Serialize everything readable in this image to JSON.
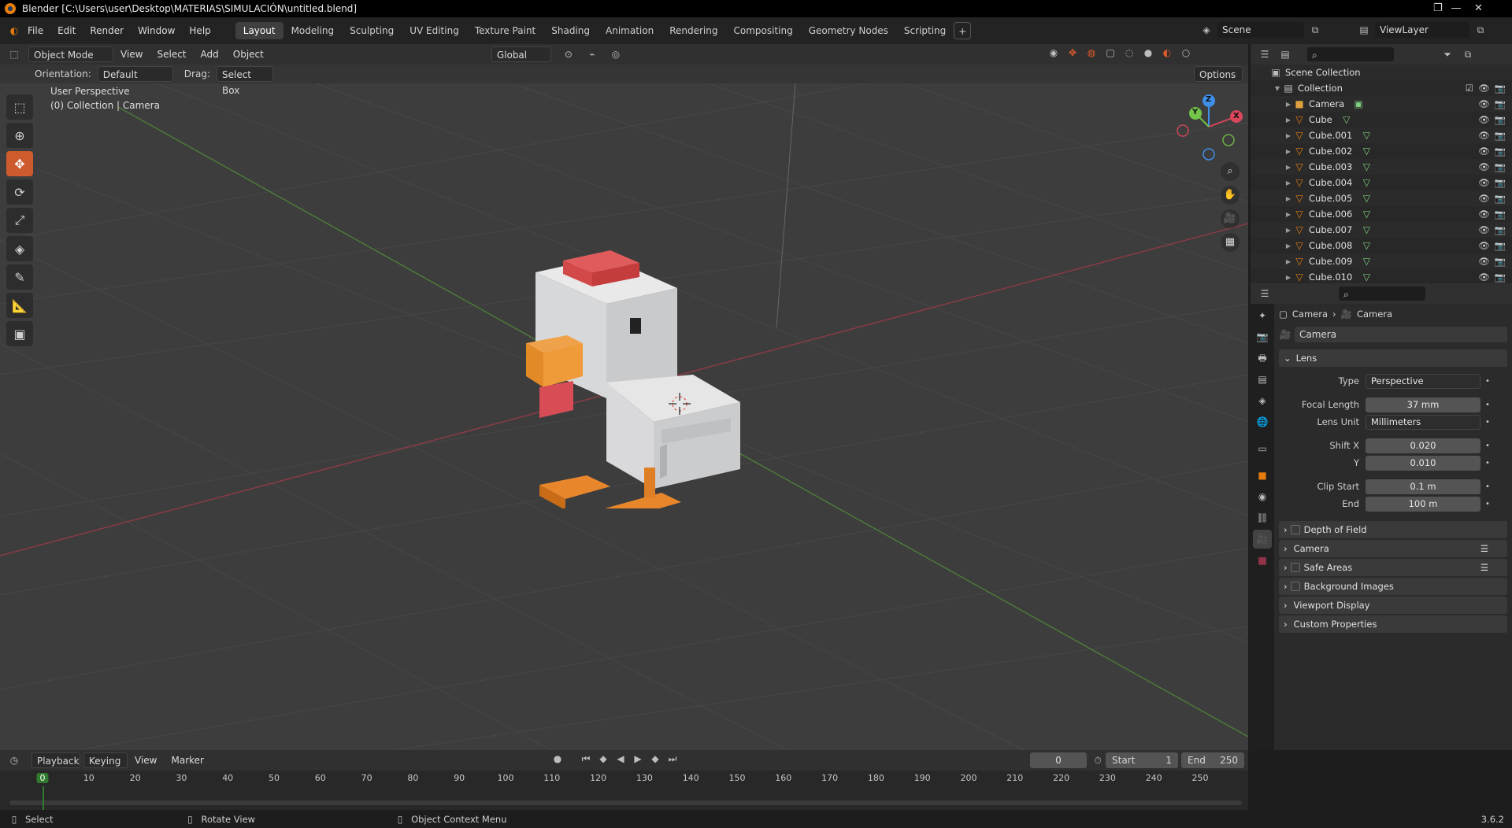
{
  "window": {
    "title": "Blender [C:\\Users\\user\\Desktop\\MATERIAS\\SIMULACIÓN\\untitled.blend]",
    "minimize": "—",
    "restore": "❐",
    "close": "✕"
  },
  "menu": [
    "File",
    "Edit",
    "Render",
    "Window",
    "Help"
  ],
  "workspaces": [
    "Layout",
    "Modeling",
    "Sculpting",
    "UV Editing",
    "Texture Paint",
    "Shading",
    "Animation",
    "Rendering",
    "Compositing",
    "Geometry Nodes",
    "Scripting"
  ],
  "active_workspace": "Layout",
  "add_workspace": "+",
  "scene": {
    "name": "Scene",
    "view_layer": "ViewLayer"
  },
  "viewport": {
    "mode": "Object Mode",
    "menus": [
      "View",
      "Select",
      "Add",
      "Object"
    ],
    "transform_orientation": "Global",
    "orientation_label": "Orientation:",
    "orientation_value": "Default",
    "drag_label": "Drag:",
    "drag_value": "Select Box",
    "options": "Options",
    "overlay_title": "User Perspective",
    "overlay_subtitle": "(0) Collection | Camera",
    "gizmo": {
      "z": "Z",
      "y": "Y",
      "x": "X"
    },
    "axis_colors": {
      "x": "#d9475a",
      "y": "#73c54a",
      "z": "#3f8fe8"
    }
  },
  "tools": [
    "select-box-icon",
    "cursor-icon",
    "move-icon",
    "rotate-icon",
    "scale-icon",
    "transform-icon",
    "annotate-icon",
    "measure-icon",
    "add-cube-icon"
  ],
  "outliner": {
    "root": "Scene Collection",
    "collection": "Collection",
    "items": [
      "Camera",
      "Cube",
      "Cube.001",
      "Cube.002",
      "Cube.003",
      "Cube.004",
      "Cube.005",
      "Cube.006",
      "Cube.007",
      "Cube.008",
      "Cube.009",
      "Cube.010"
    ]
  },
  "properties": {
    "breadcrumb": [
      "Camera",
      "Camera"
    ],
    "datablock": "Camera",
    "lens": {
      "title": "Lens",
      "type_label": "Type",
      "type": "Perspective",
      "focal_label": "Focal Length",
      "focal": "37 mm",
      "unit_label": "Lens Unit",
      "unit": "Millimeters",
      "shiftx_label": "Shift X",
      "shiftx": "0.020",
      "shifty_label": "Y",
      "shifty": "0.010",
      "clipstart_label": "Clip Start",
      "clipstart": "0.1 m",
      "clipend_label": "End",
      "clipend": "100 m"
    },
    "panels": [
      "Depth of Field",
      "Camera",
      "Safe Areas",
      "Background Images",
      "Viewport Display",
      "Custom Properties"
    ]
  },
  "timeline": {
    "menus": [
      "Playback",
      "Keying",
      "View",
      "Marker"
    ],
    "current_frame": "0",
    "start_label": "Start",
    "start": "1",
    "end_label": "End",
    "end": "250",
    "ticks": [
      "0",
      "10",
      "20",
      "30",
      "40",
      "50",
      "60",
      "70",
      "80",
      "90",
      "100",
      "110",
      "120",
      "130",
      "140",
      "150",
      "160",
      "170",
      "180",
      "190",
      "200",
      "210",
      "220",
      "230",
      "240",
      "250"
    ]
  },
  "status": {
    "select": "Select",
    "rotate": "Rotate View",
    "context": "Object Context Menu",
    "version": "3.6.2"
  }
}
